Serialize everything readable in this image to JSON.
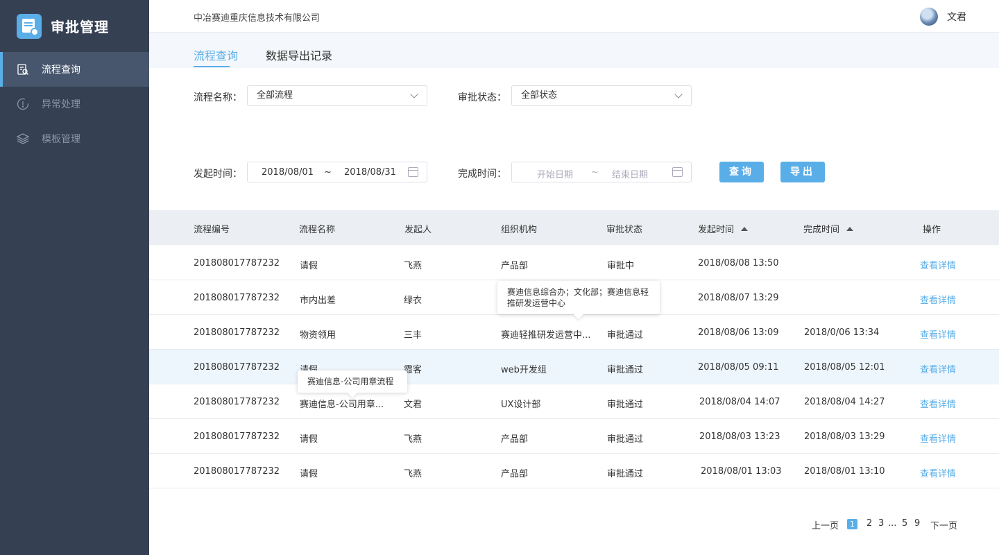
{
  "app": {
    "title": "审批管理",
    "company": "中冶赛迪重庆信息技术有限公司",
    "user": "文君",
    "accent": "#5aaee8",
    "sidebar_bg": "#354052"
  },
  "sidebar": {
    "items": [
      {
        "label": "流程查询",
        "icon": "search-doc-icon",
        "active": true
      },
      {
        "label": "异常处理",
        "icon": "alert-icon",
        "active": false
      },
      {
        "label": "模板管理",
        "icon": "layers-icon",
        "active": false
      }
    ]
  },
  "tabs": [
    {
      "label": "流程查询",
      "active": true
    },
    {
      "label": "数据导出记录",
      "active": false
    }
  ],
  "filters": {
    "process_name_label": "流程名称：",
    "process_name_value": "全部流程",
    "status_label": "审批状态：",
    "status_value": "全部状态",
    "start_time_label": "发起时间：",
    "start_from": "2018/08/01",
    "start_sep": "~",
    "start_to": "2018/08/31",
    "finish_time_label": "完成时间：",
    "finish_from_placeholder": "开始日期",
    "finish_sep": "~",
    "finish_to_placeholder": "结束日期",
    "query_button": "查询",
    "export_button": "导出"
  },
  "table": {
    "headers": [
      "流程编号",
      "流程名称",
      "发起人",
      "组织机构",
      "审批状态",
      "发起时间",
      "完成时间",
      "操作"
    ],
    "rows": [
      [
        "201808017787232",
        "请假",
        "飞燕",
        "产品部",
        "审批中",
        "2018/08/08 13:50",
        "",
        "查看详情"
      ],
      [
        "201808017787232",
        "市内出差",
        "绿衣",
        "",
        "",
        "2018/08/07 13:29",
        "",
        "查看详情"
      ],
      [
        "201808017787232",
        "物资领用",
        "三丰",
        "赛迪轻推研发运营中...",
        "审批通过",
        "2018/08/06 13:09",
        "2018/0/06 13:34",
        "查看详情"
      ],
      [
        "201808017787232",
        "请假",
        "霞客",
        "web开发组",
        "审批通过",
        "2018/08/05 09:11",
        "2018/08/05 12:01",
        "查看详情"
      ],
      [
        "201808017787232",
        "赛迪信息-公司用章...",
        "文君",
        "UX设计部",
        "审批通过",
        "2018/08/04 14:07",
        "2018/08/04 14:27",
        "查看详情"
      ],
      [
        "201808017787232",
        "请假",
        "飞燕",
        "产品部",
        "审批通过",
        "2018/08/03 13:23",
        "2018/08/03 13:29",
        "查看详情"
      ],
      [
        "201808017787232",
        "请假",
        "飞燕",
        "产品部",
        "审批通过",
        "2018/08/01 13:03",
        "2018/08/01 13:10",
        "查看详情"
      ]
    ]
  },
  "tooltips": {
    "org_line1": "赛迪信息综合办；文化部；赛迪信息轻",
    "org_line2": "推研发运营中心",
    "process": "赛迪信息-公司用章流程"
  },
  "pagination": {
    "prev": "上一页",
    "current": "1",
    "pages": [
      "2",
      "3",
      "...",
      "5",
      "9"
    ],
    "next": "下一页"
  }
}
